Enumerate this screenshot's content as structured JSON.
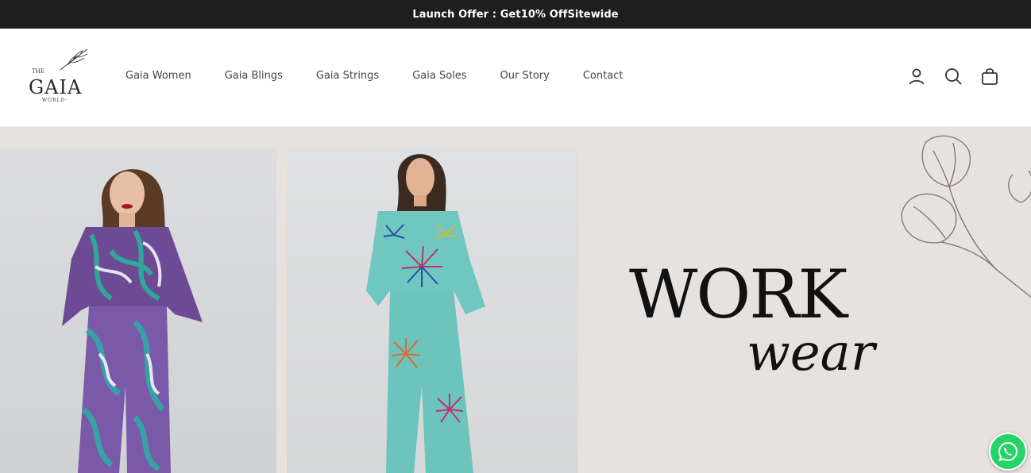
{
  "announcement": {
    "prefix": "Launch Offer : Get ",
    "highlight": "10% Off",
    "suffix": " Sitewide"
  },
  "logo": {
    "the": "THE",
    "name": "GAIA",
    "world": "·WORLD·"
  },
  "nav": {
    "items": [
      {
        "label": "Gaia Women"
      },
      {
        "label": "Gaia Blings"
      },
      {
        "label": "Gaia Strings"
      },
      {
        "label": "Gaia Soles"
      },
      {
        "label": "Our Story"
      },
      {
        "label": "Contact"
      }
    ]
  },
  "header_icons": [
    "account-icon",
    "search-icon",
    "cart-icon"
  ],
  "hero": {
    "title": "WORK",
    "subtitle": "wear"
  },
  "colors": {
    "announcement_bg": "#1e1e1e",
    "hero_bg": "#e6e2df",
    "whatsapp": "#25d366"
  }
}
